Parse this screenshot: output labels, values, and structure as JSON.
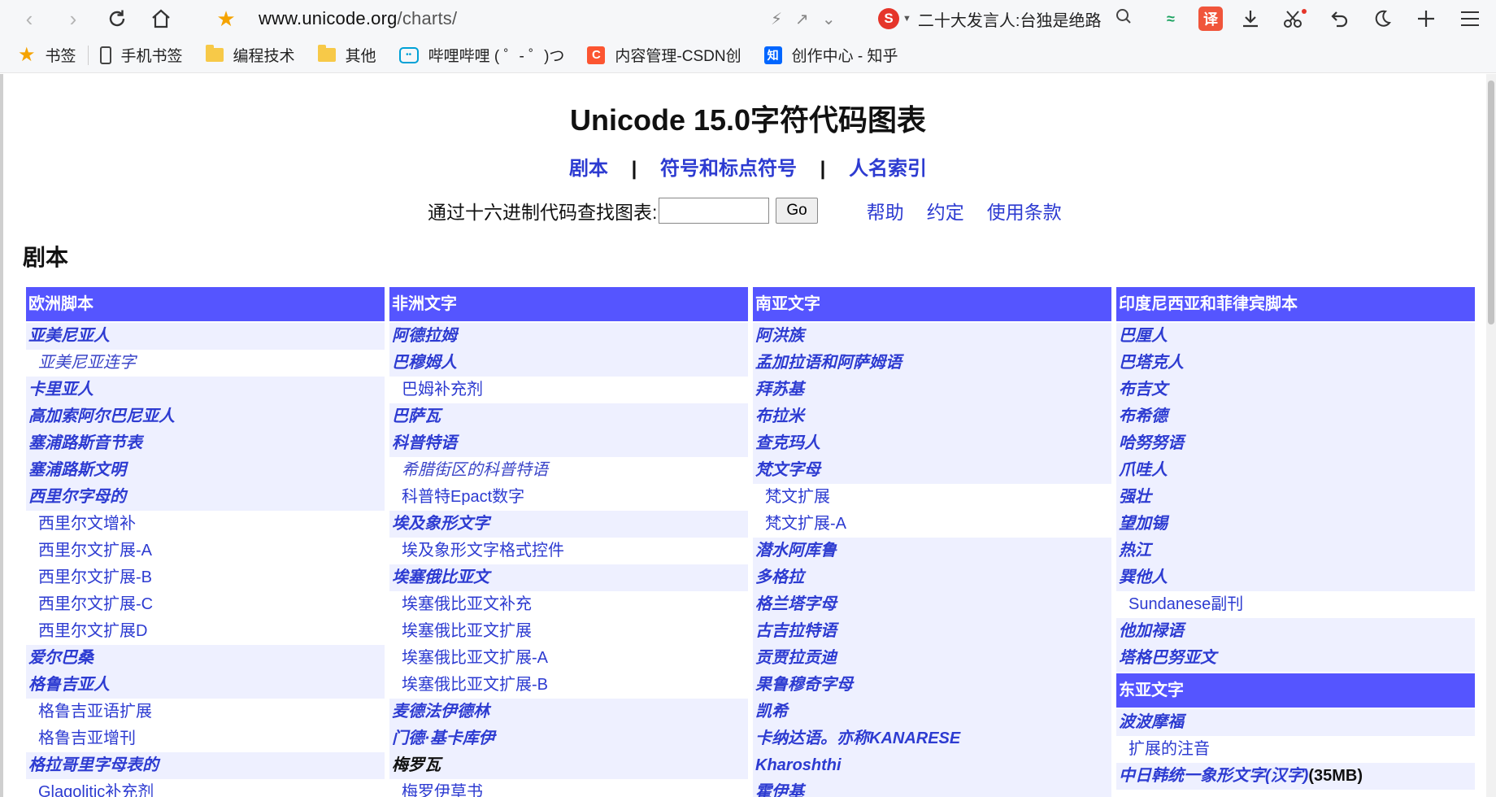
{
  "browser": {
    "url_host": "www.unicode.org",
    "url_path": "/charts/",
    "search_text": "二十大发言人:台独是绝路",
    "search_engine_icon": "S",
    "translate_label": "译",
    "green_icon": "≈"
  },
  "bookmarks": [
    {
      "label": "书签",
      "icon": "star"
    },
    {
      "label": "手机书签",
      "icon": "phone"
    },
    {
      "label": "编程技术",
      "icon": "folder"
    },
    {
      "label": "其他",
      "icon": "folder"
    },
    {
      "label": "哔哩哔哩 ( ゜- ゜)つ",
      "icon": "bilibili"
    },
    {
      "label": "内容管理-CSDN创",
      "icon": "csdn"
    },
    {
      "label": "创作中心 - 知乎",
      "icon": "zhihu"
    }
  ],
  "bookmark_icon_text": {
    "bilibili": "••",
    "csdn": "C",
    "zhihu": "知"
  },
  "page": {
    "title": "Unicode 15.0字符代码图表",
    "nav": [
      "剧本",
      "符号和标点符号",
      "人名索引"
    ],
    "find_label": "通过十六进制代码查找图表:",
    "find_value": "",
    "go_label": "Go",
    "links": [
      "帮助",
      "约定",
      "使用条款"
    ],
    "section": "剧本"
  },
  "columns": [
    {
      "blocks": [
        {
          "header": "欧洲脚本",
          "rows": [
            {
              "t": "亚美尼亚人",
              "k": "main"
            },
            {
              "t": "亚美尼亚连字",
              "k": "sub-ital"
            },
            {
              "t": "卡里亚人",
              "k": "main"
            },
            {
              "t": "高加索阿尔巴尼亚人",
              "k": "main"
            },
            {
              "t": "塞浦路斯音节表",
              "k": "main"
            },
            {
              "t": "塞浦路斯文明",
              "k": "main"
            },
            {
              "t": "西里尔字母的",
              "k": "main"
            },
            {
              "t": "西里尔文增补",
              "k": "sub"
            },
            {
              "t": "西里尔文扩展-A",
              "k": "sub"
            },
            {
              "t": "西里尔文扩展-B",
              "k": "sub"
            },
            {
              "t": "西里尔文扩展-C",
              "k": "sub"
            },
            {
              "t": "西里尔文扩展D",
              "k": "sub"
            },
            {
              "t": "爱尔巴桑",
              "k": "main"
            },
            {
              "t": "格鲁吉亚人",
              "k": "main"
            },
            {
              "t": "格鲁吉亚语扩展",
              "k": "sub"
            },
            {
              "t": "格鲁吉亚增刊",
              "k": "sub"
            },
            {
              "t": "格拉哥里字母表的",
              "k": "main"
            },
            {
              "t": "Glagolitic补充剂",
              "k": "sub"
            }
          ]
        }
      ]
    },
    {
      "blocks": [
        {
          "header": "非洲文字",
          "rows": [
            {
              "t": "阿德拉姆",
              "k": "main"
            },
            {
              "t": "巴穆姆人",
              "k": "main"
            },
            {
              "t": "巴姆补充剂",
              "k": "sub"
            },
            {
              "t": "巴萨瓦",
              "k": "main"
            },
            {
              "t": "科普特语",
              "k": "main"
            },
            {
              "t": "希腊街区的科普特语",
              "k": "sub-ital"
            },
            {
              "t": "科普特Epact数字",
              "k": "sub"
            },
            {
              "t": "埃及象形文字",
              "k": "main"
            },
            {
              "t": "埃及象形文字格式控件",
              "k": "sub"
            },
            {
              "t": "埃塞俄比亚文",
              "k": "main"
            },
            {
              "t": "埃塞俄比亚文补充",
              "k": "sub"
            },
            {
              "t": "埃塞俄比亚文扩展",
              "k": "sub"
            },
            {
              "t": "埃塞俄比亚文扩展-A",
              "k": "sub"
            },
            {
              "t": "埃塞俄比亚文扩展-B",
              "k": "sub"
            },
            {
              "t": "麦德法伊德林",
              "k": "main"
            },
            {
              "t": "门德·基卡库伊",
              "k": "main"
            },
            {
              "t": "梅罗瓦",
              "k": "main-black"
            },
            {
              "t": "梅罗伊草书",
              "k": "sub"
            }
          ]
        }
      ]
    },
    {
      "blocks": [
        {
          "header": "南亚文字",
          "rows": [
            {
              "t": "阿洪族",
              "k": "main"
            },
            {
              "t": "孟加拉语和阿萨姆语",
              "k": "main"
            },
            {
              "t": "拜苏基",
              "k": "main"
            },
            {
              "t": "布拉米",
              "k": "main"
            },
            {
              "t": "查克玛人",
              "k": "main"
            },
            {
              "t": "梵文字母",
              "k": "main"
            },
            {
              "t": "梵文扩展",
              "k": "sub"
            },
            {
              "t": "梵文扩展-A",
              "k": "sub"
            },
            {
              "t": "潜水阿库鲁",
              "k": "main"
            },
            {
              "t": "多格拉",
              "k": "main"
            },
            {
              "t": "格兰塔字母",
              "k": "main"
            },
            {
              "t": "古吉拉特语",
              "k": "main"
            },
            {
              "t": "贡贾拉贡迪",
              "k": "main"
            },
            {
              "t": "果鲁穆奇字母",
              "k": "main"
            },
            {
              "t": "凯希",
              "k": "main"
            },
            {
              "t": "卡纳达语。亦称KANARESE",
              "k": "main"
            },
            {
              "t": "Kharoshthi",
              "k": "main"
            },
            {
              "t": "霍伊基",
              "k": "main"
            }
          ]
        }
      ]
    },
    {
      "blocks": [
        {
          "header": "印度尼西亚和菲律宾脚本",
          "rows": [
            {
              "t": "巴厘人",
              "k": "main"
            },
            {
              "t": "巴塔克人",
              "k": "main"
            },
            {
              "t": "布吉文",
              "k": "main"
            },
            {
              "t": "布希德",
              "k": "main"
            },
            {
              "t": "哈努努语",
              "k": "main"
            },
            {
              "t": "爪哇人",
              "k": "main"
            },
            {
              "t": "强壮",
              "k": "main"
            },
            {
              "t": "望加锡",
              "k": "main"
            },
            {
              "t": "热江",
              "k": "main"
            },
            {
              "t": "巽他人",
              "k": "main"
            },
            {
              "t": "Sundanese副刊",
              "k": "sub"
            },
            {
              "t": "他加禄语",
              "k": "main"
            },
            {
              "t": "塔格巴努亚文",
              "k": "main"
            }
          ]
        },
        {
          "header": "东亚文字",
          "rows": [
            {
              "t": "波波摩福",
              "k": "main"
            },
            {
              "t": "扩展的注音",
              "k": "sub"
            },
            {
              "t": "中日韩统一象形文字(汉字)",
              "k": "main",
              "size": "(35MB)"
            }
          ]
        }
      ]
    }
  ]
}
